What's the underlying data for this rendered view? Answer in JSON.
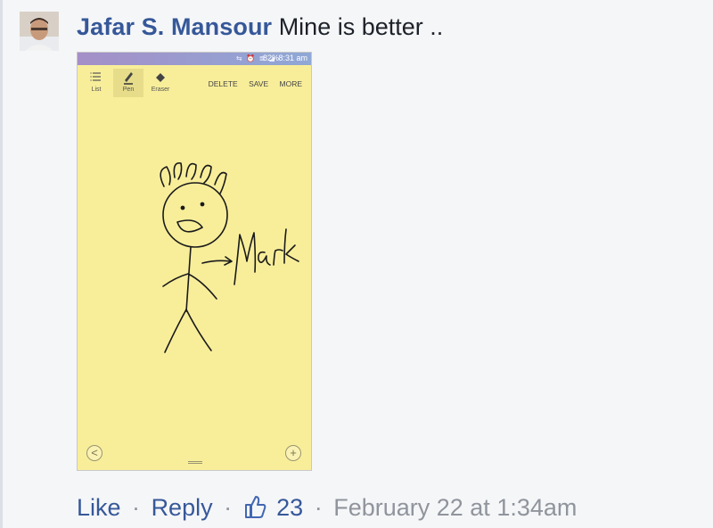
{
  "comment": {
    "author": "Jafar S. Mansour",
    "text": "Mine is better .."
  },
  "attachment": {
    "status_bar": {
      "icons": "⇆ ⏰ ≣ ◢",
      "battery": "82%",
      "time": "8:31 am"
    },
    "toolbar": {
      "tools": [
        "List",
        "Pen",
        "Eraser"
      ],
      "actions": [
        "DELETE",
        "SAVE",
        "MORE"
      ]
    },
    "sketch_label": "Mark"
  },
  "actions": {
    "like": "Like",
    "reply": "Reply",
    "separator": "·",
    "like_count": "23",
    "timestamp": "February 22 at 1:34am"
  }
}
